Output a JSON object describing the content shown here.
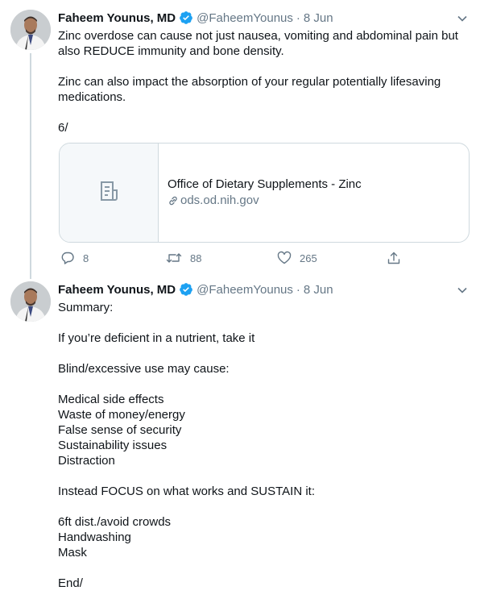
{
  "tweets": [
    {
      "author_name": "Faheem Younus, MD",
      "handle": "@FaheemYounus",
      "separator": "·",
      "date": "8 Jun",
      "text": "Zinc overdose can cause not just nausea, vomiting and abdominal pain but also REDUCE immunity and bone density.\n\nZinc can also impact the absorption of your regular potentially lifesaving medications.\n\n6/",
      "card": {
        "title": "Office of Dietary Supplements - Zinc",
        "domain": "ods.od.nih.gov"
      },
      "actions": {
        "replies": "8",
        "retweets": "88",
        "likes": "265"
      }
    },
    {
      "author_name": "Faheem Younus, MD",
      "handle": "@FaheemYounus",
      "separator": "·",
      "date": "8 Jun",
      "text": "Summary:\n\nIf you’re deficient in a nutrient, take it\n\nBlind/excessive use may cause:\n\nMedical side effects\nWaste of money/energy\nFalse sense of security\nSustainability issues\nDistraction\n\nInstead FOCUS on what works and SUSTAIN it:\n\n6ft dist./avoid crowds\nHandwashing\nMask\n\nEnd/"
    }
  ],
  "colors": {
    "accent": "#1da1f2",
    "muted": "#657786",
    "border": "#cfd9de"
  },
  "icons": [
    "verified-badge-icon",
    "chevron-down-icon",
    "document-icon",
    "link-icon",
    "reply-icon",
    "retweet-icon",
    "like-icon",
    "share-icon"
  ]
}
